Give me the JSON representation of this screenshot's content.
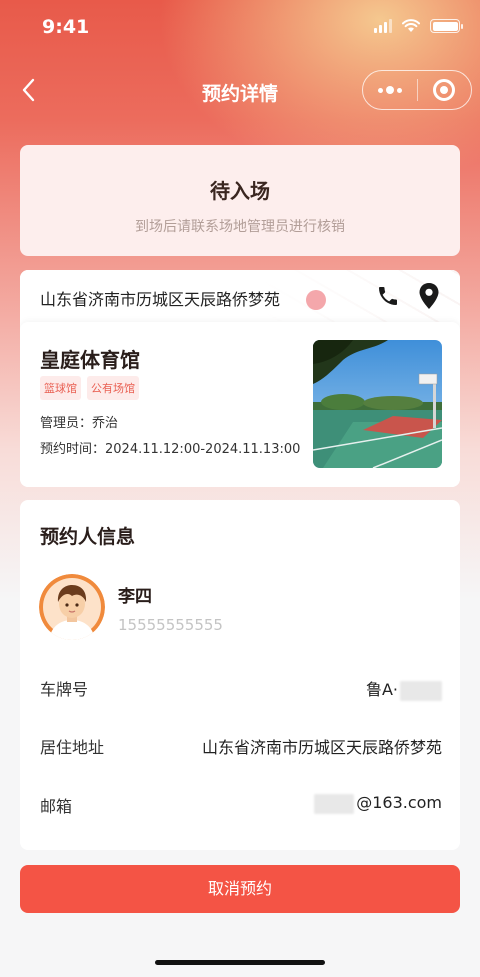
{
  "status_bar": {
    "time": "9:41"
  },
  "nav": {
    "title": "预约详情"
  },
  "booking_status": {
    "title": "待入场",
    "subtitle": "到场后请联系场地管理员进行核销"
  },
  "venue": {
    "address": "山东省济南市历城区天辰路侨梦苑",
    "name": "皇庭体育馆",
    "tags": [
      "篮球馆",
      "公有场馆"
    ],
    "manager": "管理员：乔治",
    "booking_time": "预约时间：2024.11.12:00-2024.11.13:00"
  },
  "booker": {
    "section_title": "预约人信息",
    "name": "李四",
    "phone": "15555555555",
    "fields": [
      {
        "label": "车牌号",
        "value": "鲁A·"
      },
      {
        "label": "居住地址",
        "value": "山东省济南市历城区天辰路侨梦苑"
      },
      {
        "label": "邮箱",
        "value": "@163.com"
      }
    ]
  },
  "actions": {
    "cancel_label": "取消预约"
  },
  "colors": {
    "accent": "#f45445",
    "tag_text": "#e96053",
    "status_card_bg": "#fdeeed"
  },
  "icons": [
    "back-icon",
    "more-dots-icon",
    "close-target-icon",
    "phone-icon",
    "location-pin-icon"
  ]
}
